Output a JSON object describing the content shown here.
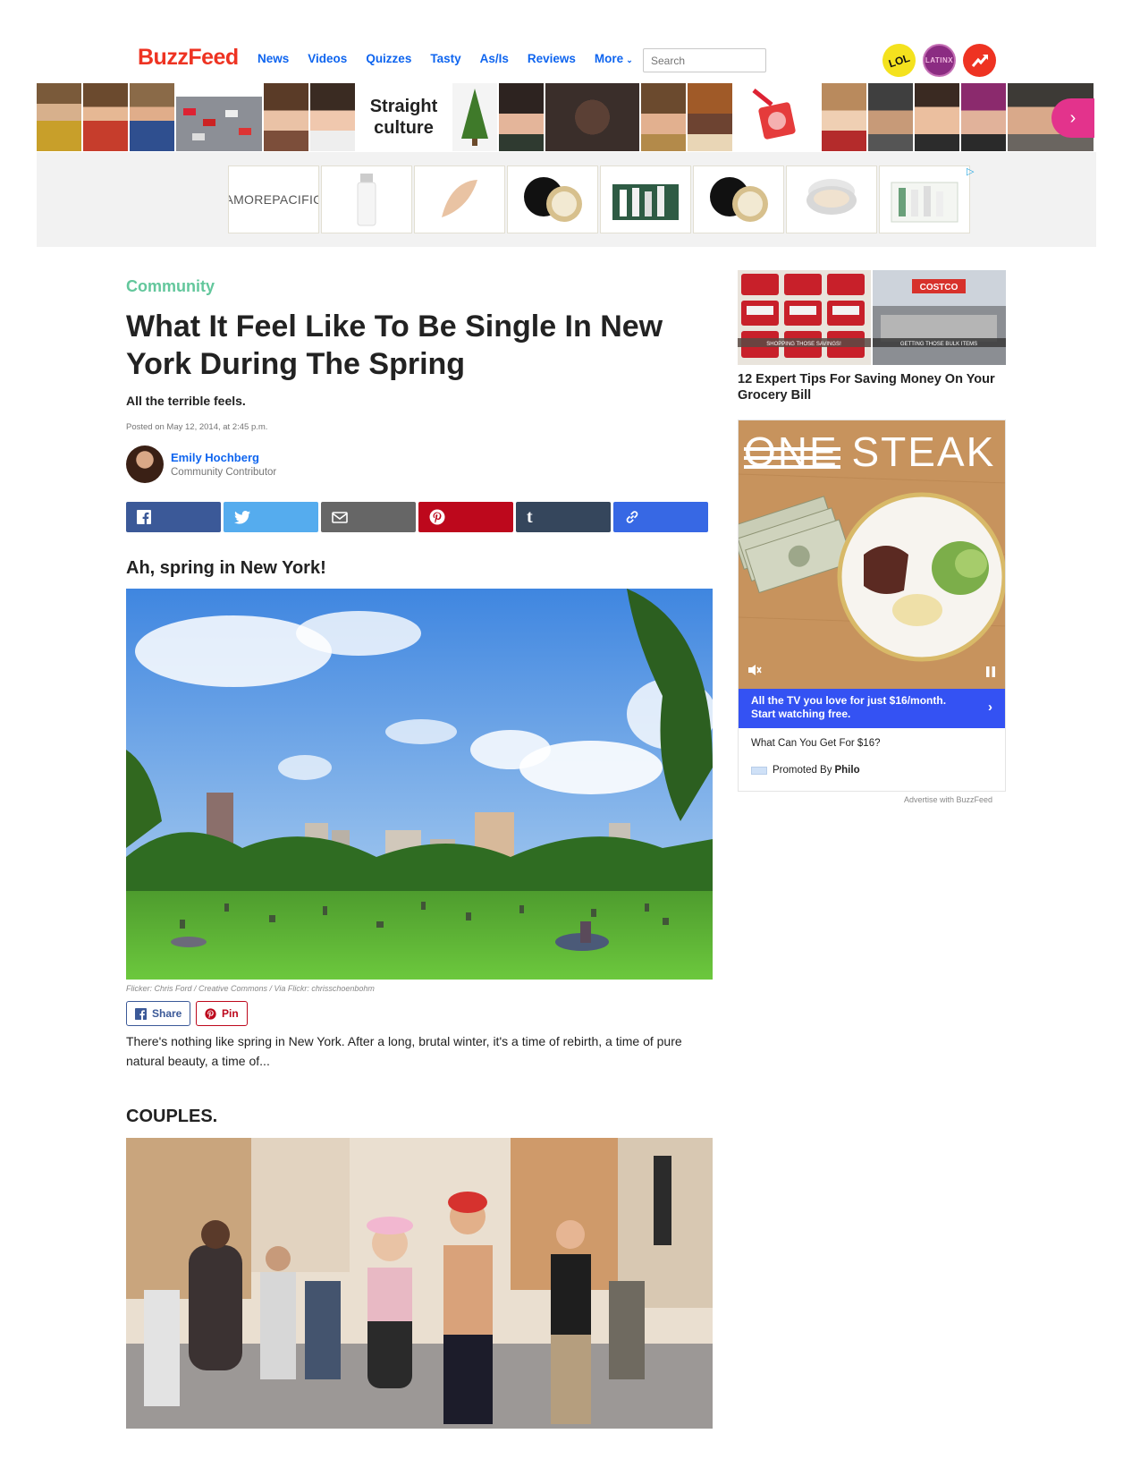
{
  "header": {
    "logo": "BuzzFeed",
    "nav": [
      "News",
      "Videos",
      "Quizzes",
      "Tasty",
      "As/Is",
      "Reviews",
      "More"
    ],
    "search_placeholder": "Search",
    "badges": {
      "lol": "LOL",
      "latinx": "LATINX"
    }
  },
  "strip": {
    "text_tile": "Straight culture",
    "next_icon": "chevron-right-icon"
  },
  "ad": {
    "brand": "AMOREPACIFIC",
    "adchoices_icon": "play-triangle-icon"
  },
  "article": {
    "category": "Community",
    "title": "What It Feel Like To Be Single In New York During The Spring",
    "dek": "All the terrible feels.",
    "posted": "Posted on May 12, 2014, at 2:45 p.m.",
    "author_name": "Emily Hochberg",
    "author_role": "Community Contributor",
    "share_icons": [
      "facebook-icon",
      "twitter-icon",
      "email-icon",
      "pinterest-icon",
      "tumblr-icon",
      "link-icon"
    ],
    "section1_heading": "Ah, spring in New York!",
    "photo_credit": "Flicker: Chris Ford / Creative Commons / Via Flickr: chrisschoenbohm",
    "share_label": "Share",
    "pin_label": "Pin",
    "body": "There's nothing like spring in New York. After a long, brutal winter, it's a time of rebirth, a time of pure natural beauty, a time of...",
    "section2_heading": "COUPLES."
  },
  "sidebar": {
    "related_title": "12 Expert Tips For Saving Money On Your Grocery Bill",
    "related_captions": [
      "SHOPPING THOSE SAVINGS!",
      "GETTING THOSE BULK ITEMS"
    ],
    "video_headline_strike": "ONE",
    "video_headline": "STEAK",
    "cta": "All the TV you love for just $16/month. Start watching free.",
    "question": "What Can You Get For $16?",
    "promoted_by": "Promoted By",
    "promoter": "Philo",
    "advertise": "Advertise with BuzzFeed"
  },
  "colors": {
    "brand_red": "#ee3322",
    "link_blue": "#0f65ef",
    "community_green": "#63c79c",
    "cta_blue": "#3452f3"
  }
}
